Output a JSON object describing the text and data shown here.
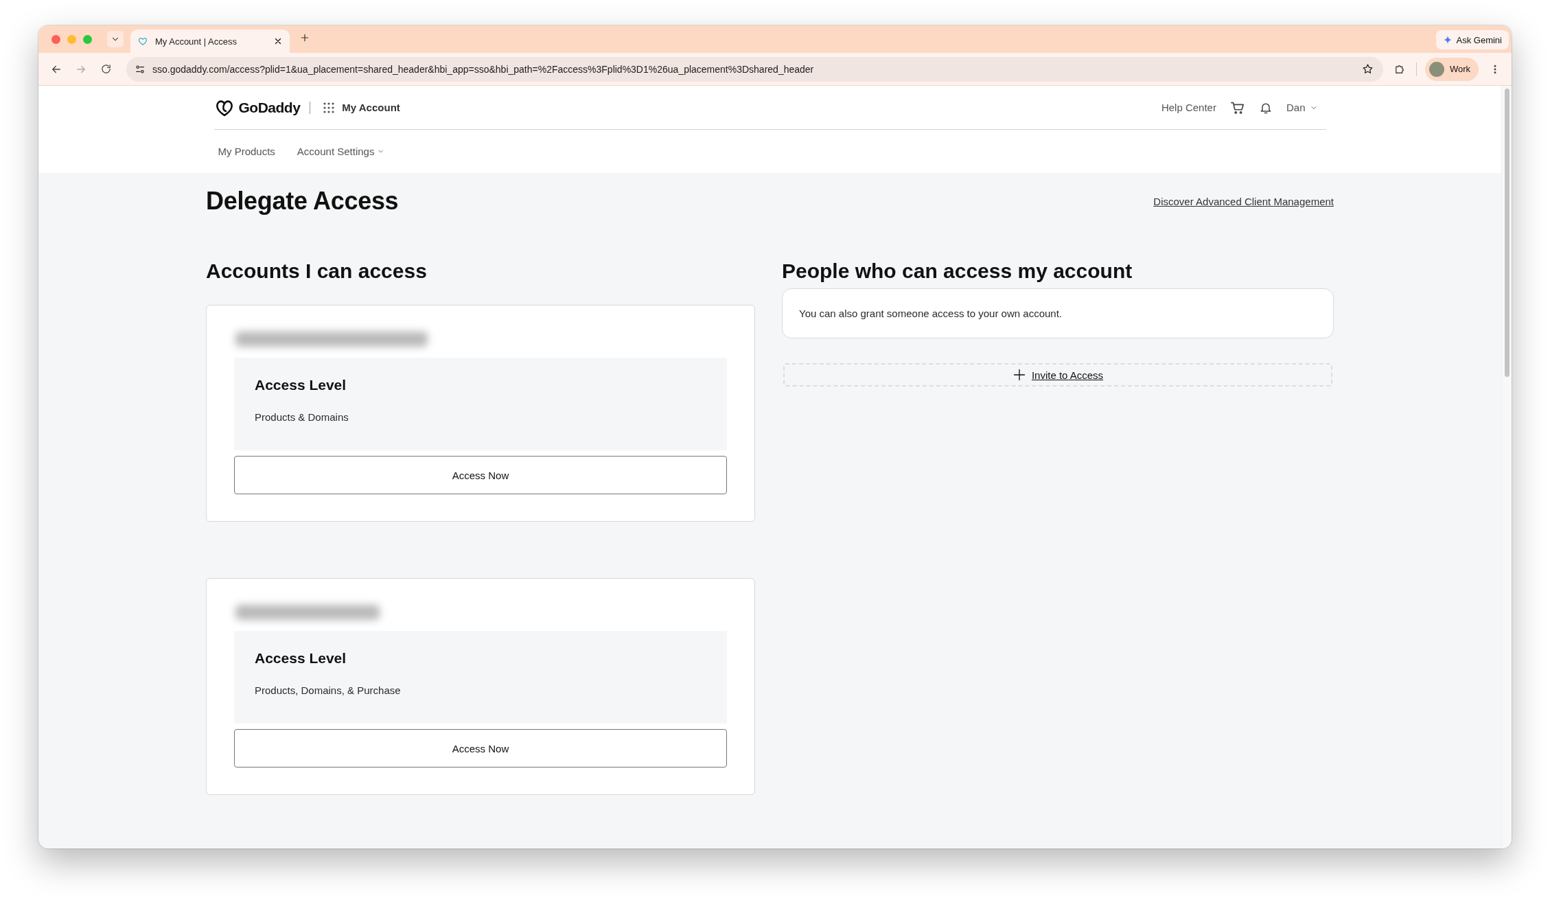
{
  "browser": {
    "tab_title": "My Account | Access",
    "url": "sso.godaddy.com/access?plid=1&ua_placement=shared_header&hbi_app=sso&hbi_path=%2Faccess%3Fplid%3D1%26ua_placement%3Dshared_header",
    "gemini_button": "Ask Gemini",
    "profile": "Work"
  },
  "header": {
    "brand": "GoDaddy",
    "app_menu": "My Account",
    "help": "Help Center",
    "user": "Dan"
  },
  "nav": [
    {
      "label": "My Products",
      "kind": "link"
    },
    {
      "label": "Account Settings",
      "kind": "dropdown"
    }
  ],
  "page": {
    "title": "Delegate Access",
    "link": "Discover Advanced Client Management"
  },
  "accounts": {
    "heading": "Accounts I can access",
    "items": [
      {
        "name_blurred": true,
        "access_title": "Access Level",
        "access": "Products & Domains",
        "button": "Access Now"
      },
      {
        "name_blurred": true,
        "access_title": "Access Level",
        "access": "Products, Domains, & Purchase",
        "button": "Access Now"
      }
    ]
  },
  "people": {
    "heading": "People who can access my account",
    "note": "You can also grant someone access to your own account.",
    "invite": "Invite to Access"
  }
}
